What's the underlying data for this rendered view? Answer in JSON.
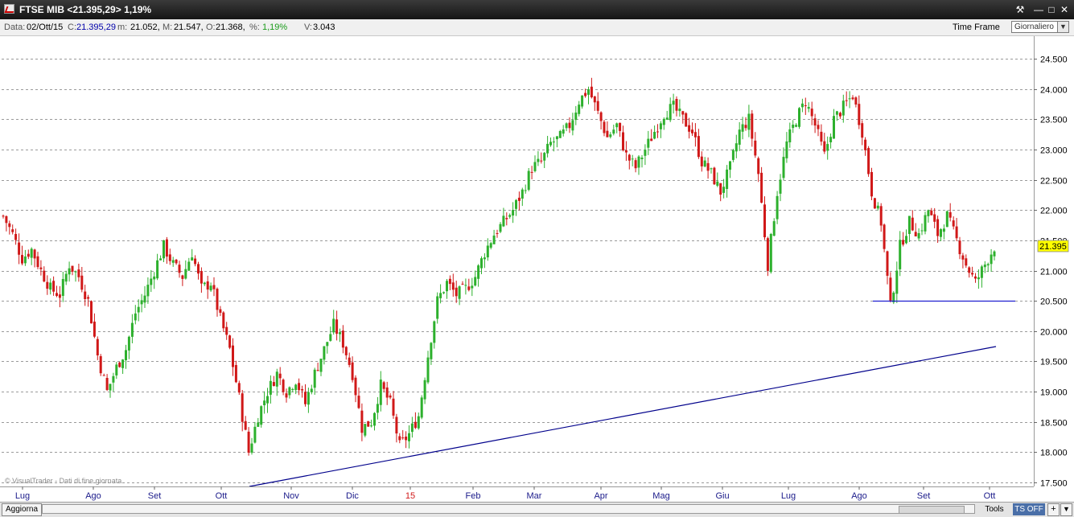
{
  "window": {
    "title": "FTSE MIB <21.395,29> 1,19%"
  },
  "info": {
    "data_label": "Data:",
    "data_value": "02/Ott/15",
    "c_label": "C:",
    "c_value": "21.395,29",
    "m_label": "m:",
    "m_value": "21.052,",
    "M_label": "M:",
    "M_value": "21.547,",
    "o_label": "O:",
    "o_value": "21.368,",
    "pct_label": "%:",
    "pct_value": "1,19%",
    "v_label": "V:",
    "v_value": "3.043"
  },
  "timeframe": {
    "label": "Time Frame",
    "selected": "Giornaliero"
  },
  "colors": {
    "up": "#2db02d",
    "down": "#d01818",
    "trendline": "#00008b",
    "price_badge": "#ffff00",
    "ts_off": "#4a6fa8"
  },
  "chart_data": {
    "type": "candlestick",
    "instrument": "FTSE MIB",
    "ylim": [
      17500,
      24700
    ],
    "y_ticks": [
      "17.500",
      "18.000",
      "18.500",
      "19.000",
      "19.500",
      "20.000",
      "20.500",
      "21.000",
      "21.500",
      "22.000",
      "22.500",
      "23.000",
      "23.500",
      "24.000",
      "24.500"
    ],
    "x_tick_labels": [
      "Lug",
      "Ago",
      "Set",
      "Ott",
      "Nov",
      "Dic",
      "15",
      "Feb",
      "Mar",
      "Apr",
      "Mag",
      "Giu",
      "Lug",
      "Ago",
      "Set",
      "Ott"
    ],
    "grid": true,
    "last_price_label": "21.395",
    "approx_close_path": [
      [
        0,
        21900
      ],
      [
        3,
        21600
      ],
      [
        6,
        21200
      ],
      [
        9,
        21350
      ],
      [
        12,
        21000
      ],
      [
        15,
        20700
      ],
      [
        18,
        20600
      ],
      [
        21,
        21100
      ],
      [
        24,
        20900
      ],
      [
        27,
        20500
      ],
      [
        30,
        19600
      ],
      [
        33,
        19000
      ],
      [
        36,
        19400
      ],
      [
        39,
        19700
      ],
      [
        42,
        20300
      ],
      [
        45,
        20600
      ],
      [
        48,
        21000
      ],
      [
        51,
        21400
      ],
      [
        54,
        21100
      ],
      [
        57,
        20900
      ],
      [
        60,
        21300
      ],
      [
        63,
        20700
      ],
      [
        66,
        20800
      ],
      [
        69,
        20200
      ],
      [
        72,
        19700
      ],
      [
        75,
        18900
      ],
      [
        78,
        18000
      ],
      [
        81,
        18600
      ],
      [
        84,
        19000
      ],
      [
        87,
        19300
      ],
      [
        90,
        19000
      ],
      [
        93,
        19200
      ],
      [
        96,
        18800
      ],
      [
        99,
        19300
      ],
      [
        102,
        19700
      ],
      [
        105,
        20100
      ],
      [
        108,
        19800
      ],
      [
        111,
        19300
      ],
      [
        114,
        18400
      ],
      [
        117,
        18500
      ],
      [
        120,
        19100
      ],
      [
        123,
        18800
      ],
      [
        126,
        18100
      ],
      [
        129,
        18300
      ],
      [
        132,
        18600
      ],
      [
        135,
        19600
      ],
      [
        138,
        20500
      ],
      [
        141,
        20800
      ],
      [
        144,
        20600
      ],
      [
        147,
        20700
      ],
      [
        150,
        20900
      ],
      [
        153,
        21300
      ],
      [
        156,
        21600
      ],
      [
        159,
        21800
      ],
      [
        162,
        22000
      ],
      [
        165,
        22300
      ],
      [
        168,
        22700
      ],
      [
        171,
        22800
      ],
      [
        174,
        23100
      ],
      [
        177,
        23200
      ],
      [
        180,
        23400
      ],
      [
        183,
        23800
      ],
      [
        186,
        24000
      ],
      [
        189,
        23600
      ],
      [
        192,
        23200
      ],
      [
        195,
        23400
      ],
      [
        198,
        22900
      ],
      [
        201,
        22700
      ],
      [
        204,
        23000
      ],
      [
        207,
        23300
      ],
      [
        210,
        23600
      ],
      [
        213,
        23700
      ],
      [
        216,
        23500
      ],
      [
        219,
        23300
      ],
      [
        222,
        22800
      ],
      [
        225,
        22600
      ],
      [
        228,
        22300
      ],
      [
        231,
        22700
      ],
      [
        234,
        23300
      ],
      [
        237,
        23500
      ],
      [
        240,
        22600
      ],
      [
        243,
        21100
      ],
      [
        246,
        22300
      ],
      [
        249,
        23100
      ],
      [
        252,
        23500
      ],
      [
        255,
        23800
      ],
      [
        258,
        23400
      ],
      [
        261,
        22900
      ],
      [
        264,
        23500
      ],
      [
        267,
        23700
      ],
      [
        270,
        23900
      ],
      [
        273,
        23300
      ],
      [
        276,
        22300
      ],
      [
        279,
        21800
      ],
      [
        282,
        20400
      ],
      [
        285,
        21400
      ],
      [
        288,
        21800
      ],
      [
        291,
        21600
      ],
      [
        294,
        22000
      ],
      [
        297,
        21600
      ],
      [
        300,
        21900
      ],
      [
        303,
        21500
      ],
      [
        306,
        21100
      ],
      [
        309,
        20800
      ],
      [
        312,
        21100
      ],
      [
        315,
        21395
      ]
    ],
    "annotations": [
      "© VisualTrader - Dati di fine giornata"
    ]
  },
  "bottom": {
    "aggiorna": "Aggiorna",
    "tools": "Tools",
    "tsoff": "TS OFF",
    "plus": "+"
  }
}
